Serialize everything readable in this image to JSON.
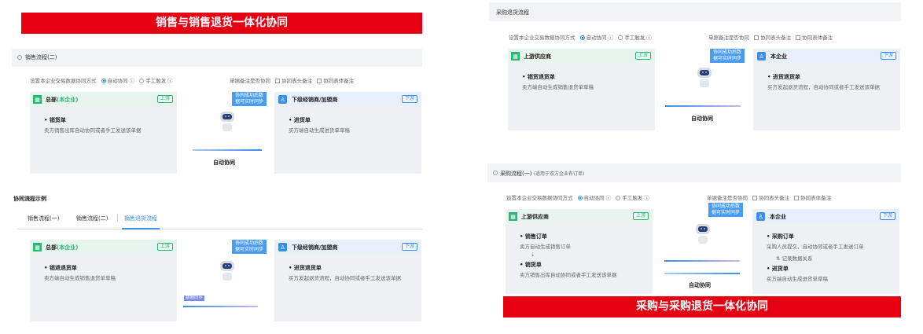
{
  "colors": {
    "banner_red": "#e60012",
    "accent_blue": "#3b8fe8",
    "accent_green": "#2bb673"
  },
  "banners": {
    "left": "销售与销售退货一体化协同",
    "right": "采购与采购退货一体化协同"
  },
  "common": {
    "settings_label": "设置本企业交易数据协同方式",
    "auto_sync": "自动协同",
    "manual_trigger": "手工触发",
    "remark_sync_label": "单据备注是否协同",
    "header_remark": "协同表头备注",
    "body_remark": "协同表体备注",
    "bubble": "协同成功后数据可实时同步",
    "auto_sync_label": "自动协同",
    "upstream": "上游",
    "downstream": "下游"
  },
  "sales2": {
    "title": "销售流程(二)",
    "left_name_prefix": "总部",
    "left_name_suffix": "(本企业)",
    "left_item_title": "销货单",
    "left_item_desc": "卖方销售出库自动协同或者手工发送该单据",
    "right_name": "下级经销商/加盟商",
    "right_item_title": "进货单",
    "right_item_desc": "买方端自动生成进货单草稿"
  },
  "example": {
    "section_title": "协同流程示例",
    "tabs": [
      "销售流程(一)",
      "销售流程(二)",
      "销售退货流程"
    ],
    "left_name_prefix": "总部",
    "left_name_suffix": "(本企业)",
    "left_item_title": "销退退货单",
    "left_item_desc": "卖方端自动生成销售退货单草稿",
    "right_name": "下级经销商/加盟商",
    "right_item_title": "进货退货单",
    "right_item_desc": "买方发起退货流程，自动协同或者手工发送该单据",
    "data_sync_tag": "数据同步"
  },
  "purchase_return": {
    "title": "采购退货流程",
    "left_name": "上游供应商",
    "left_item_title": "销货退货单",
    "left_item_desc": "卖方端自动生成销售退货单草稿",
    "right_name": "本企业",
    "right_item_title": "进货退货单",
    "right_item_desc": "买方发起退货流程，自动协同或者手工发送该单据"
  },
  "purchase1": {
    "title": "采购流程(一)",
    "title_note": "(适用于双方企业有订单)",
    "left_name": "上游供应商",
    "left_item1_title": "销售订单",
    "left_item1_desc": "卖方自动生成销售订单",
    "left_item2_title": "销货单",
    "left_item2_desc": "卖方销售出库自动协同或者手工发送该单据",
    "right_name": "本企业",
    "right_item1_title": "采购订单",
    "right_item1_desc": "采购人员提交，自动协同或者手工发送订单",
    "right_link": "记录数据关系",
    "right_item2_title": "进货单",
    "right_item2_desc": "买方端自动生成进货单草稿"
  }
}
